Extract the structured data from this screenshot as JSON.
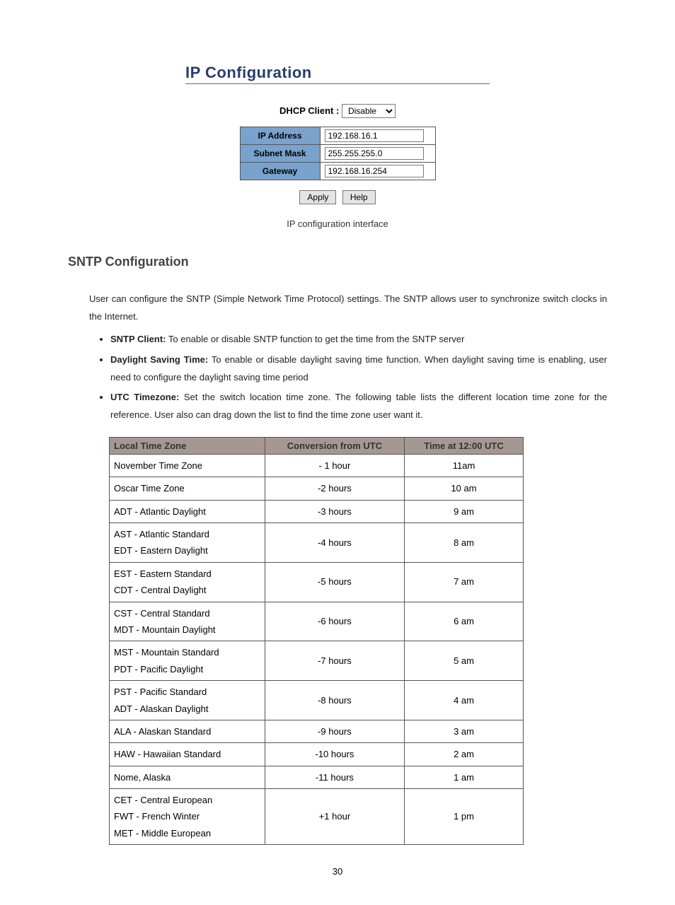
{
  "ipconf": {
    "title": "IP Configuration",
    "dhcp_label": "DHCP Client :",
    "dhcp_value": "Disable",
    "rows": [
      {
        "label": "IP Address",
        "value": "192.168.16.1"
      },
      {
        "label": "Subnet Mask",
        "value": "255.255.255.0"
      },
      {
        "label": "Gateway",
        "value": "192.168.16.254"
      }
    ],
    "apply_label": "Apply",
    "help_label": "Help",
    "caption": "IP configuration interface"
  },
  "section": {
    "heading": "SNTP Configuration",
    "intro": "User can configure the SNTP (Simple Network Time Protocol) settings. The SNTP allows user to synchronize switch clocks in the Internet.",
    "bullets": [
      {
        "bold": "SNTP Client:",
        "text": " To enable or disable SNTP function to get the time from the SNTP server"
      },
      {
        "bold": "Daylight Saving Time:",
        "text": " To enable or disable daylight saving time function. When daylight saving time is enabling, user need to configure the daylight saving time period"
      },
      {
        "bold": "UTC Timezone:",
        "text": " Set the switch location time zone. The following table lists the different location time zone for the reference. User also can drag down the list to find the time zone user want it."
      }
    ]
  },
  "tz": {
    "headers": {
      "c1": "Local Time Zone",
      "c2": "Conversion from UTC",
      "c3": "Time at 12:00 UTC"
    },
    "rows": [
      {
        "zone": "November Time Zone",
        "conv": "- 1 hour",
        "time": "11am"
      },
      {
        "zone": "Oscar Time Zone",
        "conv": "-2 hours",
        "time": "10 am"
      },
      {
        "zone": "ADT - Atlantic Daylight",
        "conv": "-3 hours",
        "time": "9 am"
      },
      {
        "zone": "AST - Atlantic Standard\nEDT - Eastern Daylight",
        "conv": "-4 hours",
        "time": "8 am"
      },
      {
        "zone": "EST - Eastern Standard\nCDT - Central Daylight",
        "conv": "-5 hours",
        "time": "7 am"
      },
      {
        "zone": "CST - Central Standard\nMDT - Mountain Daylight",
        "conv": "-6 hours",
        "time": "6 am"
      },
      {
        "zone": "MST - Mountain Standard\nPDT - Pacific Daylight",
        "conv": "-7 hours",
        "time": "5 am"
      },
      {
        "zone": "PST - Pacific Standard\nADT - Alaskan Daylight",
        "conv": "-8 hours",
        "time": "4 am"
      },
      {
        "zone": "ALA - Alaskan Standard",
        "conv": "-9 hours",
        "time": "3 am"
      },
      {
        "zone": "HAW - Hawaiian Standard",
        "conv": "-10 hours",
        "time": "2 am"
      },
      {
        "zone": "Nome, Alaska",
        "conv": "-11 hours",
        "time": "1 am"
      },
      {
        "zone": "CET - Central European\nFWT - French Winter\nMET - Middle European",
        "conv": "+1 hour",
        "time": "1 pm"
      }
    ]
  },
  "page_number": "30"
}
